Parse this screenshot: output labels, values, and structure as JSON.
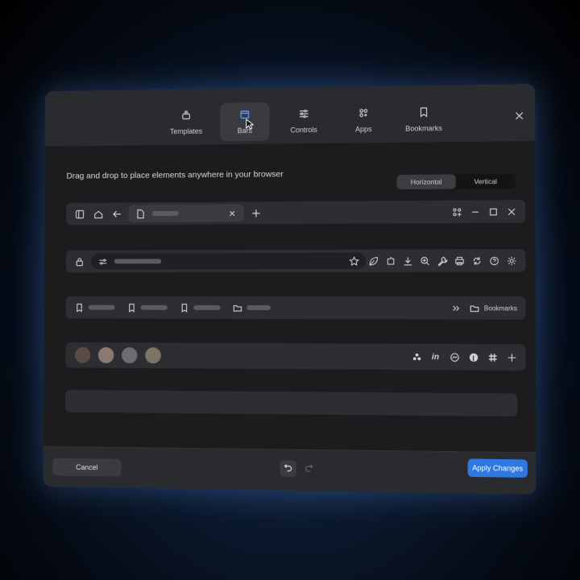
{
  "tabs": [
    {
      "label": "Templates",
      "icon": "layers-icon"
    },
    {
      "label": "Bars",
      "icon": "window-icon"
    },
    {
      "label": "Controls",
      "icon": "sliders-icon"
    },
    {
      "label": "Apps",
      "icon": "apps-icon"
    },
    {
      "label": "Bookmarks",
      "icon": "bookmark-icon"
    }
  ],
  "active_tab": "Bars",
  "hint": "Drag and drop to place elements anywhere in your browser",
  "orientation": {
    "horizontal": "Horizontal",
    "vertical": "Vertical",
    "selected": "Horizontal"
  },
  "bookmarks_folder": "Bookmarks",
  "buttons": {
    "cancel": "Cancel",
    "apply": "Apply Changes"
  },
  "colors": {
    "accent": "#2f78e0",
    "panel": "#1c1c1e",
    "bar": "#2d2e31"
  }
}
